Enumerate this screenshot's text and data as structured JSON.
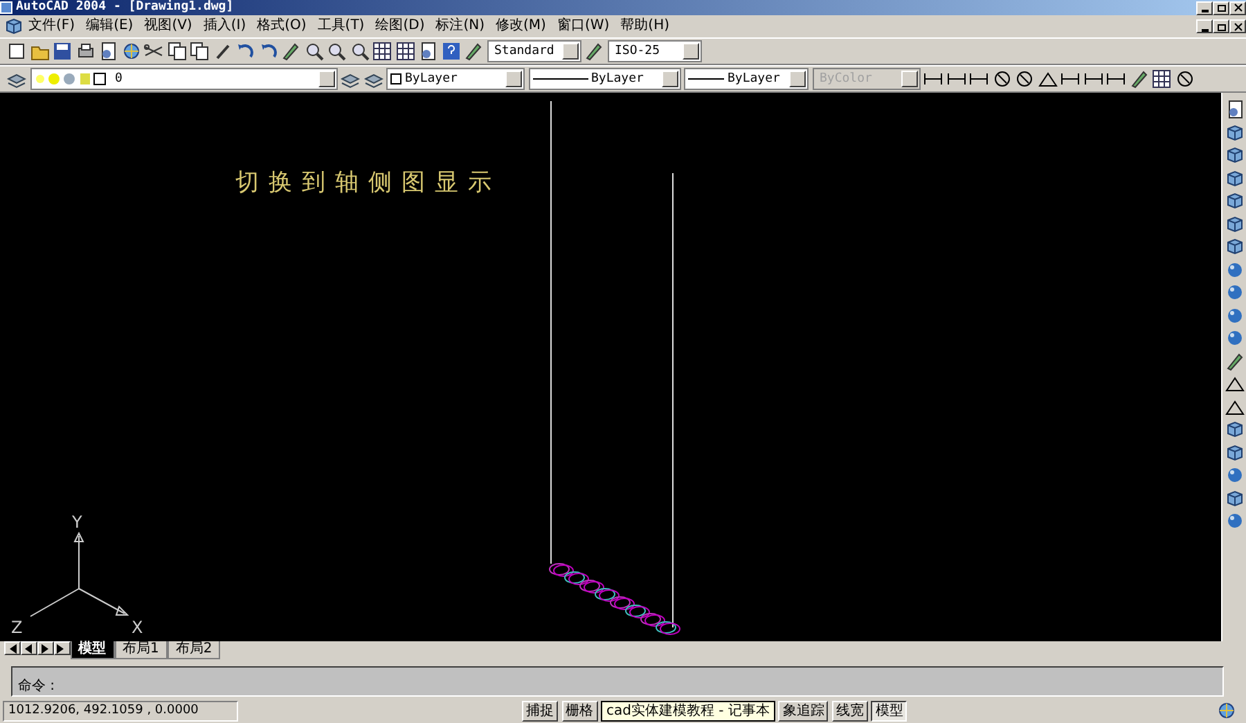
{
  "window": {
    "title": "AutoCAD 2004 - [Drawing1.dwg]"
  },
  "menu": [
    {
      "label": "文件(F)"
    },
    {
      "label": "编辑(E)"
    },
    {
      "label": "视图(V)"
    },
    {
      "label": "插入(I)"
    },
    {
      "label": "格式(O)"
    },
    {
      "label": "工具(T)"
    },
    {
      "label": "绘图(D)"
    },
    {
      "label": "标注(N)"
    },
    {
      "label": "修改(M)"
    },
    {
      "label": "窗口(W)"
    },
    {
      "label": "帮助(H)"
    }
  ],
  "styles": {
    "text_style": "Standard",
    "dim_style": "ISO-25"
  },
  "properties": {
    "layer": "0",
    "color_control": "ByLayer",
    "linetype": "ByLayer",
    "lineweight": "ByLayer",
    "plot_style": {
      "value": "ByColor",
      "disabled": true
    }
  },
  "canvas": {
    "annotation": "切换到轴侧图显示",
    "ucs": {
      "x": "X",
      "y": "Y",
      "z": "Z"
    }
  },
  "layout_tabs": [
    {
      "label": "模型",
      "selected": true
    },
    {
      "label": "布局1",
      "selected": false
    },
    {
      "label": "布局2",
      "selected": false
    }
  ],
  "command": {
    "prompt": "命令 :"
  },
  "status_bar": {
    "coordinates": "1012.9206, 492.1059 , 0.0000",
    "buttons": [
      {
        "label": "捕捉",
        "on": false
      },
      {
        "label": "栅格",
        "on": false
      }
    ],
    "tooltip": "cad实体建模教程 - 记事本",
    "buttons_after": [
      {
        "label": "象追踪",
        "on": false
      },
      {
        "label": "线宽",
        "on": false
      },
      {
        "label": "模型",
        "on": true
      }
    ]
  }
}
